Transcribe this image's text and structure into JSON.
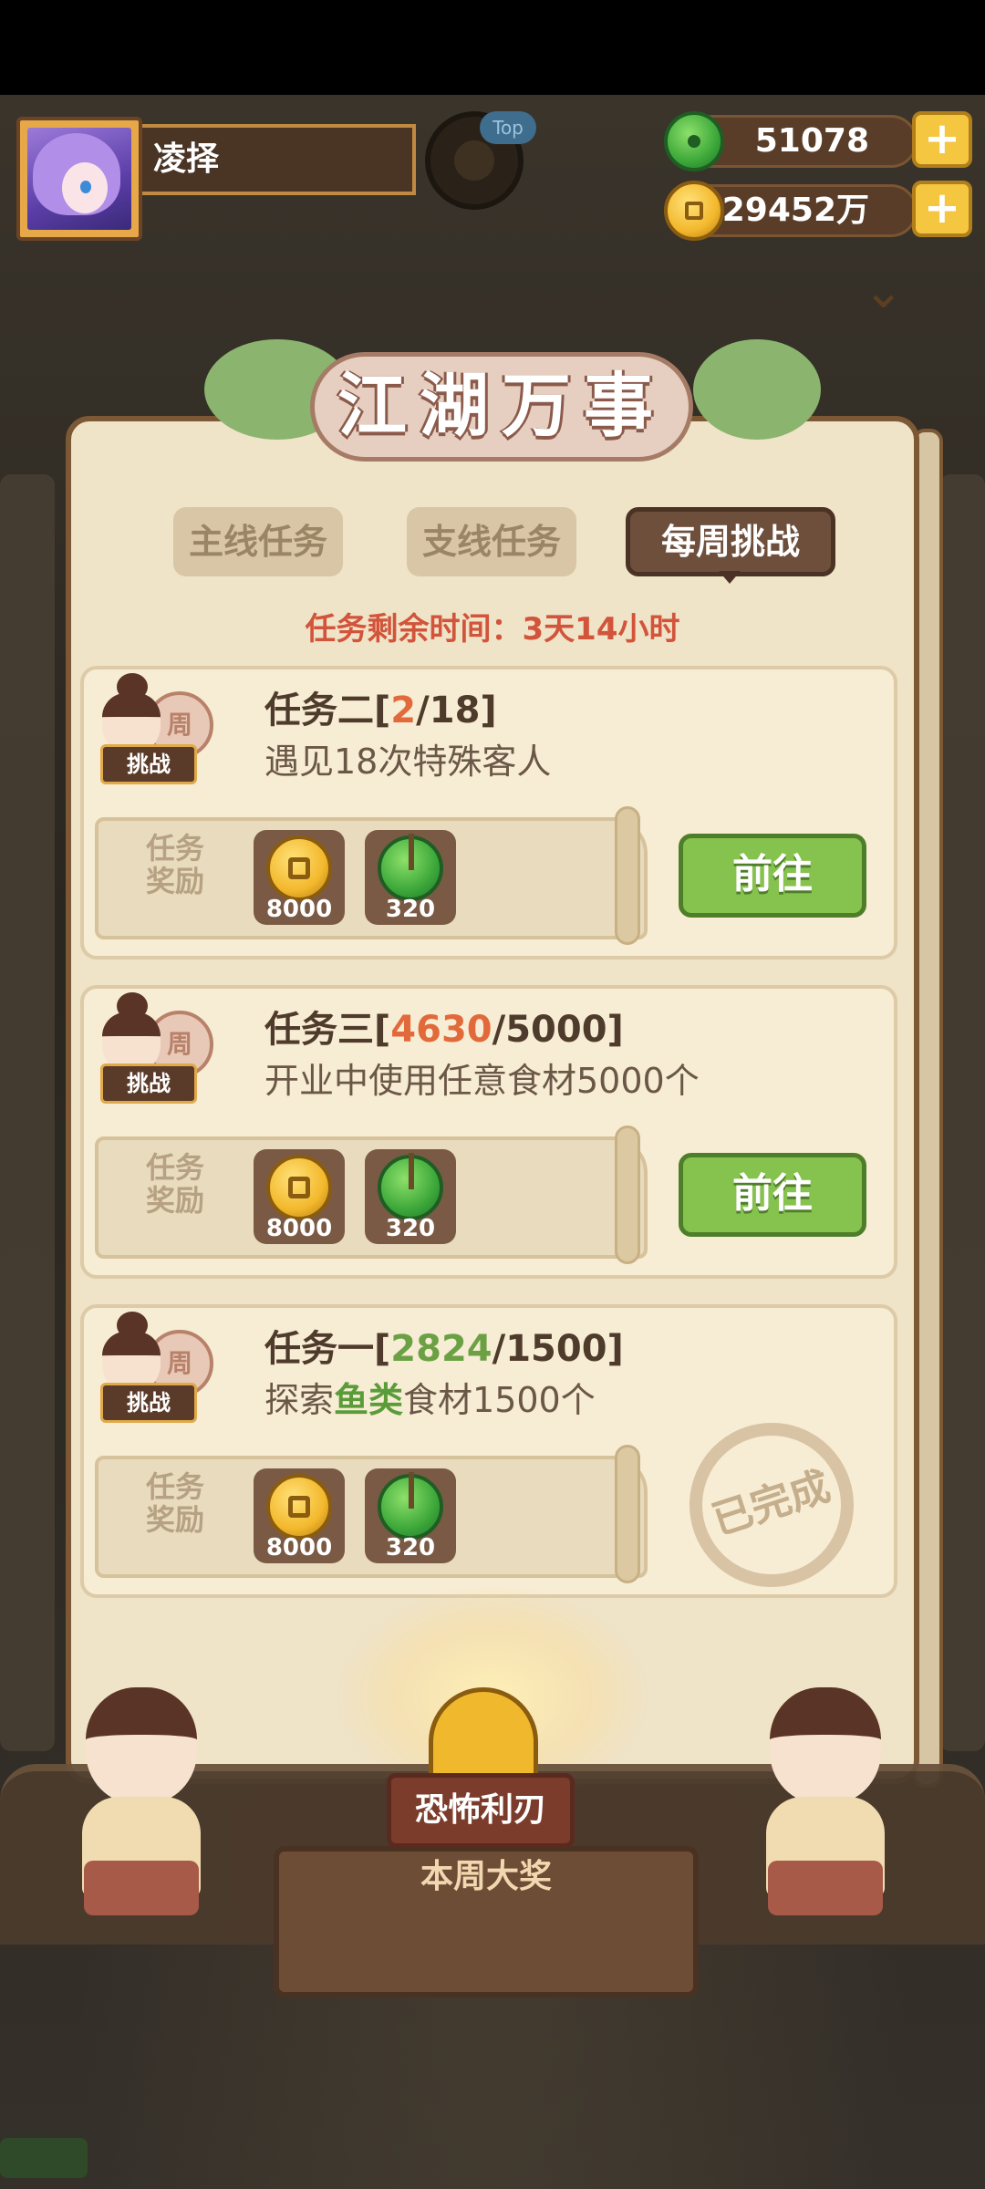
{
  "header": {
    "player_name": "凌择",
    "top_badge": "Top",
    "jade_amount": "51078",
    "coin_amount": "29452万",
    "plus_label": "+"
  },
  "panel": {
    "title": "江湖万事",
    "tabs": [
      {
        "label": "主线任务",
        "active": false
      },
      {
        "label": "支线任务",
        "active": false
      },
      {
        "label": "每周挑战",
        "active": true
      }
    ],
    "timer_text": "任务剩余时间：3天14小时"
  },
  "tasks": [
    {
      "tag": "挑战",
      "medal": "周",
      "title_prefix": "任务二[",
      "current": "2",
      "title_suffix": "/18]",
      "desc": "遇见18次特殊客人",
      "reward_label": "任务奖励",
      "rewards": [
        {
          "icon": "coin-icon",
          "value": "8000"
        },
        {
          "icon": "jade-icon",
          "value": "320"
        }
      ],
      "action": "前往"
    },
    {
      "tag": "挑战",
      "medal": "周",
      "title_prefix": "任务三[",
      "current": "4630",
      "title_suffix": "/5000]",
      "desc": "开业中使用任意食材5000个",
      "reward_label": "任务奖励",
      "rewards": [
        {
          "icon": "coin-icon",
          "value": "8000"
        },
        {
          "icon": "jade-icon",
          "value": "320"
        }
      ],
      "action": "前往"
    },
    {
      "tag": "挑战",
      "medal": "周",
      "title_prefix": "任务一[",
      "current": "2824",
      "title_suffix": "/1500]",
      "desc_prefix": "探索",
      "desc_highlight": "鱼类",
      "desc_suffix": "食材1500个",
      "reward_label": "任务奖励",
      "rewards": [
        {
          "icon": "coin-icon",
          "value": "8000"
        },
        {
          "icon": "jade-icon",
          "value": "320"
        }
      ],
      "status": "已完成"
    }
  ],
  "weekly_prize": {
    "name": "恐怖利刃",
    "label": "本周大奖"
  },
  "colors": {
    "accent_red": "#d2543a",
    "progress_red": "#e26a3a",
    "progress_green": "#6ba144",
    "button_green": "#86c24e",
    "panel_bg": "#efe3c8"
  }
}
